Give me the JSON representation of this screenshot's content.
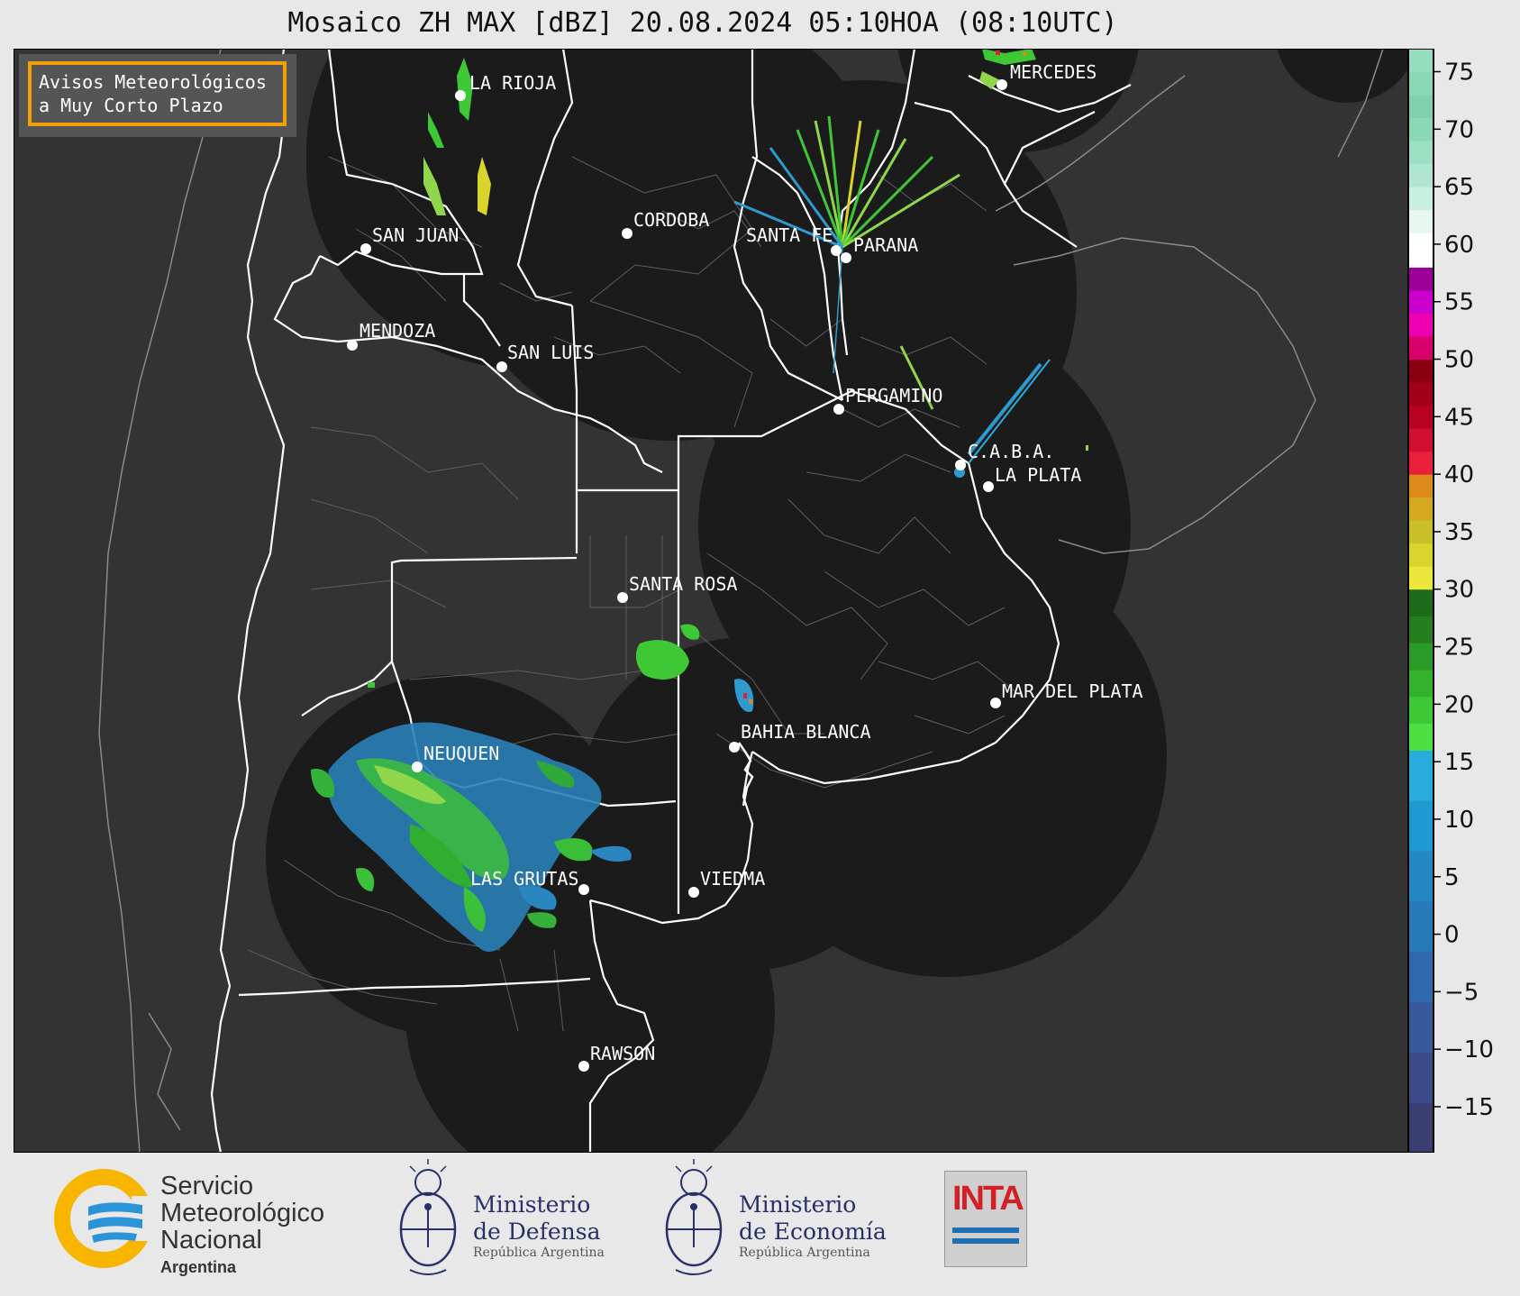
{
  "title": "Mosaico ZH MAX [dBZ] 20.08.2024 05:10HOA (08:10UTC)",
  "notice": {
    "line1": "Avisos Meteorológicos",
    "line2": "a Muy Corto Plazo",
    "border_color": "#f0a000"
  },
  "cities": [
    {
      "name": "MERCEDES"
    },
    {
      "name": "LA RIOJA"
    },
    {
      "name": "CORDOBA"
    },
    {
      "name": "SAN JUAN"
    },
    {
      "name": "SANTA FE"
    },
    {
      "name": "PARANA"
    },
    {
      "name": "MENDOZA"
    },
    {
      "name": "SAN LUIS"
    },
    {
      "name": "PERGAMINO"
    },
    {
      "name": "C.A.B.A."
    },
    {
      "name": "LA PLATA"
    },
    {
      "name": "SANTA ROSA"
    },
    {
      "name": "MAR DEL PLATA"
    },
    {
      "name": "BAHIA BLANCA"
    },
    {
      "name": "NEUQUEN"
    },
    {
      "name": "LAS GRUTAS"
    },
    {
      "name": "VIEDMA"
    },
    {
      "name": "RAWSON"
    }
  ],
  "colorbar": {
    "min": -19,
    "max": 77,
    "ticks": [
      75,
      70,
      65,
      60,
      55,
      50,
      45,
      40,
      35,
      30,
      25,
      20,
      15,
      10,
      5,
      0,
      -5,
      -10,
      -15
    ],
    "tick_labels": [
      "75",
      "70",
      "65",
      "60",
      "55",
      "50",
      "45",
      "40",
      "35",
      "30",
      "25",
      "20",
      "15",
      "10",
      "5",
      "0",
      "−5",
      "−10",
      "−15"
    ],
    "segments": [
      {
        "from": -19,
        "to": 16,
        "colors": [
          "#3a3f72",
          "#3a4b87",
          "#37589a",
          "#2f68ab",
          "#2879b8",
          "#2388c4",
          "#1f9ad0",
          "#27acdc"
        ]
      },
      {
        "from": 16,
        "to": 30,
        "colors": [
          "#4ee043",
          "#3fc836",
          "#33b02c",
          "#2c9a26",
          "#247e20",
          "#1d6a1a"
        ]
      },
      {
        "from": 30,
        "to": 40,
        "colors": [
          "#ede63a",
          "#d9d42c",
          "#c9bf28",
          "#d4a820",
          "#dc8a1a"
        ]
      },
      {
        "from": 40,
        "to": 50,
        "colors": [
          "#ea1f3a",
          "#d01030",
          "#b80020",
          "#a00018",
          "#8a0010"
        ]
      },
      {
        "from": 50,
        "to": 58,
        "colors": [
          "#d8006a",
          "#ee00b0",
          "#cc00cc",
          "#9a0096"
        ]
      },
      {
        "from": 58,
        "to": 61,
        "colors": [
          "#ffffff"
        ]
      },
      {
        "from": 61,
        "to": 77,
        "colors": [
          "#e6f7ef",
          "#c9efdf",
          "#b0e6d0",
          "#9ddfc3",
          "#8ad8b6",
          "#7fd1ad",
          "#8ad8b6",
          "#95ddbe"
        ]
      }
    ]
  },
  "footer": {
    "smn": {
      "line1": "Servicio",
      "line2": "Meteorológico",
      "line3": "Nacional",
      "line4": "Argentina"
    },
    "defensa": {
      "line1": "Ministerio",
      "line2": "de Defensa",
      "line3": "República Argentina"
    },
    "economia": {
      "line1": "Ministerio",
      "line2": "de Economía",
      "line3": "República Argentina"
    },
    "inta": {
      "label": "INTA"
    }
  }
}
